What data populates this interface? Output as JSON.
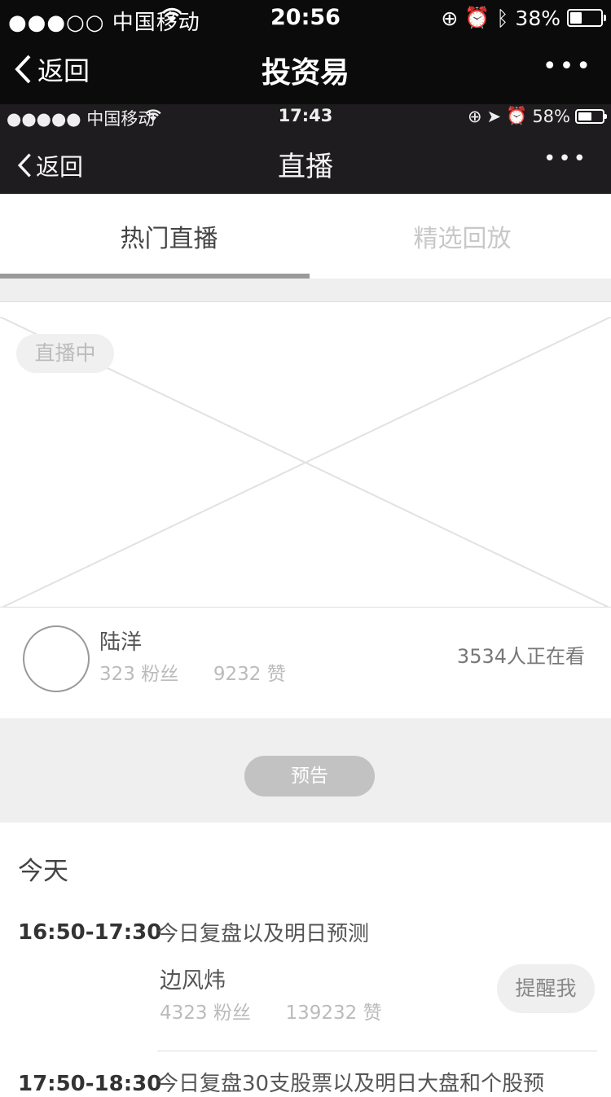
{
  "outer_status": {
    "signal": "●●●○○ 中国移动",
    "wifi_icon": "wifi-icon",
    "time": "20:56",
    "battery": "38%",
    "battery_level": 0.38
  },
  "outer_nav": {
    "back_label": "返回",
    "title": "投资易",
    "more": "•••"
  },
  "inner_status": {
    "signal": "●●●●● 中国移动",
    "time": "17:43",
    "battery": "58%",
    "battery_level": 0.58
  },
  "inner_nav": {
    "back_label": "返回",
    "title": "直播",
    "more": "•••"
  },
  "tabs": [
    {
      "label": "热门直播",
      "active": true
    },
    {
      "label": "精选回放",
      "active": false
    }
  ],
  "live": {
    "badge": "直播中",
    "streamer_name": "陆洋",
    "fans": "323 粉丝",
    "likes": "9232 赞",
    "viewers": "3534人正在看"
  },
  "preview": {
    "label": "预告"
  },
  "schedule": {
    "day": "今天",
    "items": [
      {
        "time": "16:50-17:30",
        "title": "今日复盘以及明日预测",
        "host": "边风炜",
        "fans": "4323 粉丝",
        "likes": "139232 赞",
        "action": "提醒我"
      },
      {
        "time": "17:50-18:30",
        "title": "今日复盘30支股票以及明日大盘和个股预"
      }
    ]
  }
}
